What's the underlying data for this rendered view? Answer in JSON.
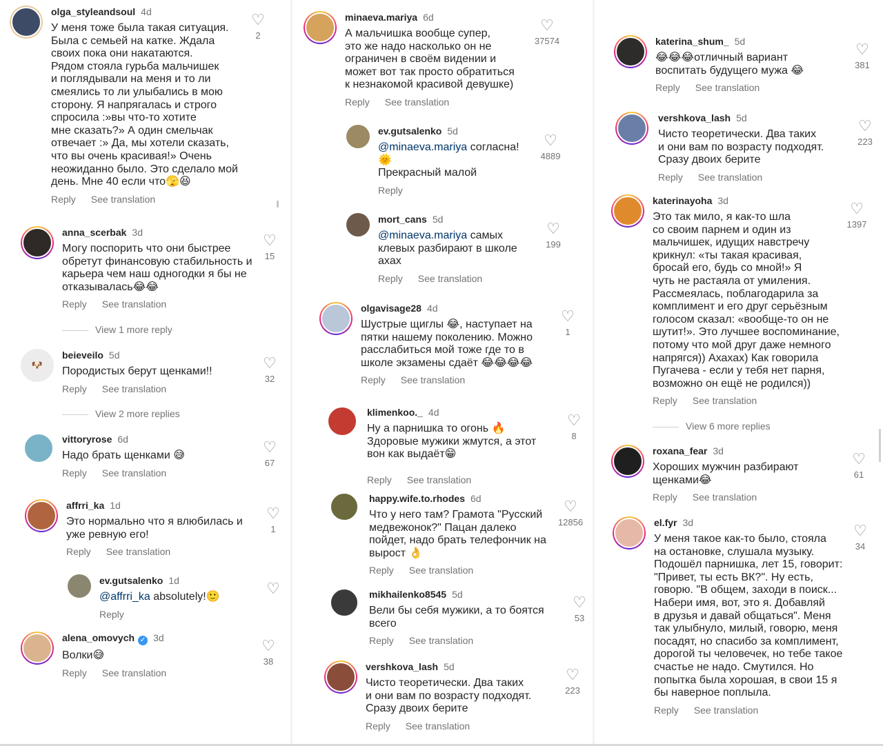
{
  "actions": {
    "reply": "Reply",
    "see_translation": "See translation"
  },
  "icons": {
    "like": "heart-outline-icon",
    "verified": "verified-badge-icon"
  },
  "colors": {
    "mention": "#00376b",
    "muted": "#737373",
    "text": "#262626",
    "verified": "#3897f0"
  },
  "left": {
    "c1": {
      "user": "olga_styleandsoul",
      "time": "4d",
      "text": "У меня тоже была такая ситуация.\nБыла с семьей на катке. Ждала\nсвоих пока они накатаются.\nРядом стояла гурьба мальчишек\nи поглядывали на меня и то ли\nсмеялись то ли улыбались в мою\nсторону. Я напрягалась и строго\nспросила :»вы что-то хотите\nмне сказать?» А один смельчак\nотвечает :» Да, мы хотели сказать,\nчто вы очень красивая!» Очень\nнеожиданно было. Это сделало мой\nдень. Мне 40 если что🫣😆",
      "likes": "2"
    },
    "c2": {
      "user": "anna_scerbak",
      "time": "3d",
      "text": "Могу поспорить что они быстрее\nобретут финансовую стабильность и\nкарьера чем наш одногодки я бы не\nотказывалась😂😂",
      "likes": "15"
    },
    "more1": "View 1 more reply",
    "c3": {
      "user": "beieveilo",
      "time": "5d",
      "text": "Породистых берут щенками!!",
      "likes": "32"
    },
    "more2": "View 2 more replies",
    "c4": {
      "user": "vittoryrose",
      "time": "6d",
      "text": "Надо брать щенками 😅",
      "likes": "67"
    },
    "c5": {
      "user": "affrri_ka",
      "time": "1d",
      "text": "Это нормально что я влюбилась и\nуже ревную его!",
      "likes": "1"
    },
    "r5": {
      "user": "ev.gutsalenko",
      "time": "1d",
      "mention": "@affrri_ka",
      "text": " absolutely!🙂"
    },
    "c6": {
      "user": "alena_omovych",
      "time": "3d",
      "text": "Волки😅",
      "likes": "38"
    }
  },
  "middle": {
    "c1": {
      "user": "minaeva.mariya",
      "time": "6d",
      "text": "А мальчишка вообще супер,\nэто же надо насколько он не\nограничен в своём видении и\nможет вот так просто обратиться\nк незнакомой красивой девушке)",
      "likes": "37574"
    },
    "r1": {
      "user": "ev.gutsalenko",
      "time": "5d",
      "mention": "@minaeva.mariya",
      "text": " согласна!\n🌞\nПрекрасный малой",
      "likes": "4889"
    },
    "r2": {
      "user": "mort_cans",
      "time": "5d",
      "mention": "@minaeva.mariya",
      "text": " самых\nклевых разбирают в школе\naxax",
      "likes": "199"
    },
    "c2": {
      "user": "olgavisage28",
      "time": "4d",
      "text": "Шустрые щиглы 😂, наступает на\nпятки нашему поколению.  Можно\nрасслабиться мой тоже где то в\nшколе экзамены сдаёт 😂😂😂😂",
      "likes": "1"
    },
    "c3": {
      "user": "klimenkoo._",
      "time": "4d",
      "text": "Ну а парнишка то огонь 🔥\nЗдоровые мужики жмутся, а этот\nвон как выдаёт😁",
      "likes": "8"
    },
    "c4": {
      "user": "happy.wife.to.rhodes",
      "time": "6d",
      "text": "Что у него там? Грамота \"Русский\nмедвежонок?\" Пацан далеко\nпойдет, надо брать телефончик на\nвырост 👌",
      "likes": "12856"
    },
    "c5": {
      "user": "mikhailenko8545",
      "time": "5d",
      "text": "Вели бы себя мужики, а то боятся\nвсего",
      "likes": "53"
    },
    "c6": {
      "user": "vershkova_lash",
      "time": "5d",
      "text": "Чисто теоретически. Два таких\nи они вам по возрасту подходят.\nСразу двоих берите",
      "likes": "223"
    }
  },
  "right": {
    "c1": {
      "user": "katerina_shum_",
      "time": "5d",
      "text": "😂😂😂отличный вариант\nвоспитать будущего мужа 😂",
      "likes": "381"
    },
    "c2": {
      "user": "vershkova_lash",
      "time": "5d",
      "text": "Чисто теоретически. Два таких\nи они вам по возрасту подходят.\nСразу двоих берите",
      "likes": "223"
    },
    "c3": {
      "user": "katerinayoha",
      "time": "3d",
      "text": "Это так мило, я как-то шла\nсо своим парнем и один из\nмальчишек, идущих навстречу\nкрикнул: «ты такая красивая,\nбросай его, будь со мной!» Я\nчуть не растаяла от умиления.\nРассмеялась, поблагодарила за\nкомплимент и его друг серьёзным\nголосом сказал: «вообще-то он не\nшутит!». Это лучшее воспоминание,\nпотому что мой друг даже немного\nнапрягся)) Ахахах) Как говорила\nПугачева - если у тебя нет парня,\nвозможно он ещё не родился))",
      "likes": "1397"
    },
    "more1": "View 6 more replies",
    "c4": {
      "user": "roxana_fear",
      "time": "3d",
      "text": "Хороших мужчин разбирают\nщенками😂",
      "likes": "61"
    },
    "c5": {
      "user": "el.fyr",
      "time": "3d",
      "text": "У меня такое как-то было, стояла\nна остановке, слушала музыку.\nПодошёл парнишка, лет 15, говорит:\n\"Привет, ты есть ВК?\". Ну есть,\nговорю. \"В общем, заходи в поиск...\nНабери имя, вот, это я. Добавляй\nв друзья и давай общаться\". Меня\nтак улыбнуло, милый, говорю, меня\nпосадят, но спасибо за комплимент,\nдорогой ты человечек, но тебе такое\nсчастье не надо. Смутился. Но\nпопытка была хорошая, в свои 15 я\nбы наверное поплыла.",
      "likes": "34"
    }
  }
}
